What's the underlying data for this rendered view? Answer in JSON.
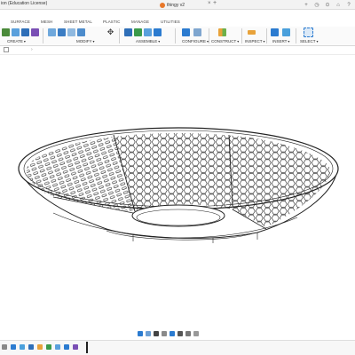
{
  "titlebar": {
    "app_title": "ion (Education License)",
    "doc_tab": "thingy v2"
  },
  "workspace_tabs": [
    "SURFACE",
    "MESH",
    "SHEET METAL",
    "PLASTIC",
    "MANAGE",
    "UTILITIES"
  ],
  "toolbar_groups": [
    {
      "label": "CREATE",
      "icons": [
        "sketch-icon",
        "extrude-icon",
        "box-icon",
        "form-icon"
      ]
    },
    {
      "label": "MODIFY",
      "icons": [
        "fillet-icon",
        "shell-icon",
        "combine-icon",
        "press-pull-icon",
        "move-icon"
      ]
    },
    {
      "label": "ASSEMBLE",
      "icons": [
        "new-component-icon",
        "joint-icon",
        "as-built-joint-icon",
        "motion-link-icon"
      ]
    },
    {
      "label": "CONFIGURE",
      "icons": [
        "configure-table-icon",
        "configure-rule-icon"
      ]
    },
    {
      "label": "CONSTRUCT",
      "icons": [
        "offset-plane-icon"
      ]
    },
    {
      "label": "INSPECT",
      "icons": [
        "measure-icon"
      ]
    },
    {
      "label": "INSERT",
      "icons": [
        "insert-derive-icon",
        "insert-image-icon"
      ]
    },
    {
      "label": "SELECT",
      "icons": [
        "select-icon"
      ]
    }
  ],
  "colors": {
    "accent_orange": "#e8782a",
    "accent_blue": "#2b7bd0",
    "accent_green": "#3a9a4a",
    "model_fill": "#ffffff",
    "model_stroke": "#222222"
  },
  "viewport": {
    "model": "perforated shallow dish with hexagon pattern"
  }
}
